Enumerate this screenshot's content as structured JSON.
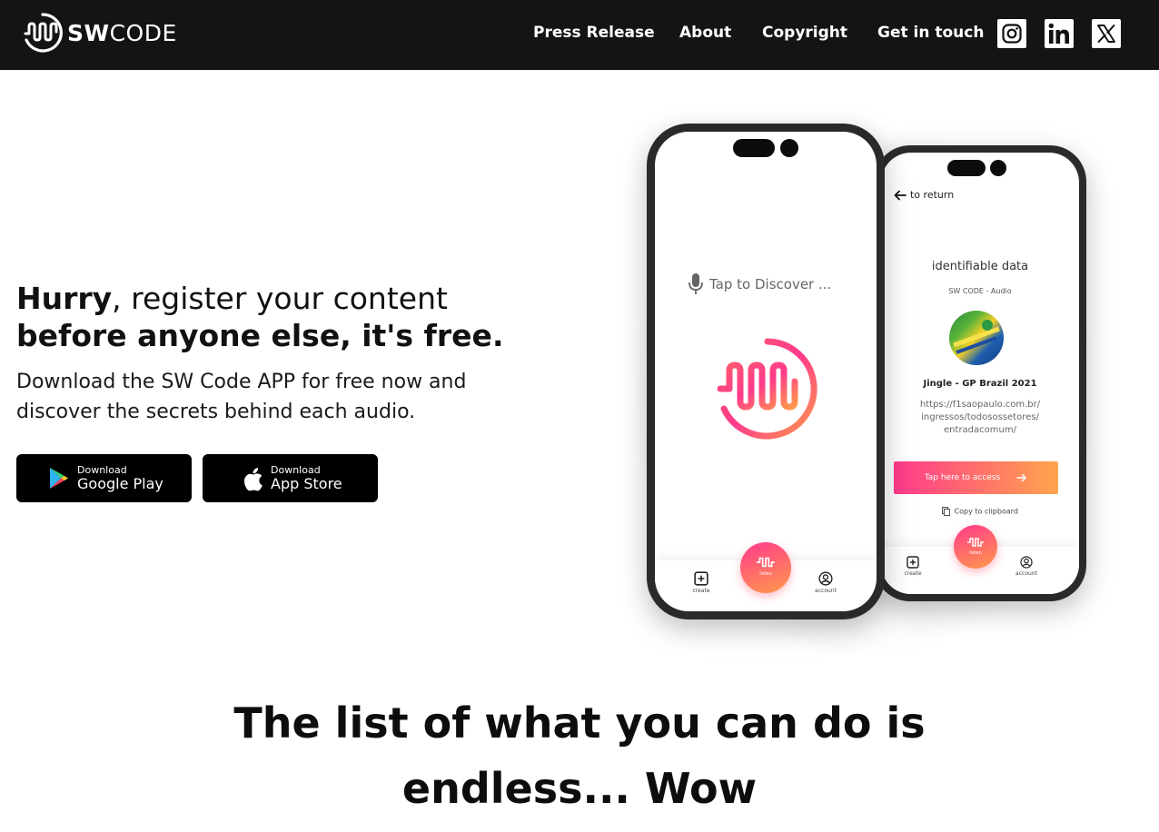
{
  "brand": {
    "name_bold": "SW",
    "name_light": "CODE"
  },
  "nav": {
    "links": [
      "Press Release",
      "About",
      "Copyright",
      "Get in touch"
    ],
    "social": [
      "instagram-icon",
      "linkedin-icon",
      "x-icon"
    ]
  },
  "hero": {
    "line1_bold": "Hurry",
    "line1_rest": ", register your content",
    "line2": "before anyone else, it's free.",
    "subtitle_line1": "Download the SW Code APP for free now and",
    "subtitle_line2": "discover the secrets behind each audio."
  },
  "stores": [
    {
      "small": "Download",
      "big": "Google Play",
      "icon": "google-play-icon"
    },
    {
      "small": "Download",
      "big": "App Store",
      "icon": "apple-icon"
    }
  ],
  "phone_left": {
    "prompt": "Tap to Discover ...",
    "tabs": {
      "create": "create",
      "listen": "listen",
      "account": "account"
    }
  },
  "phone_right": {
    "back": "to return",
    "heading": "identifiable data",
    "source": "SW CODE - Audio",
    "track": "Jingle - GP Brazil 2021",
    "url_line1": "https://f1saopaulo.com.br/",
    "url_line2": "ingressos/todosossetores/",
    "url_line3": "entradacomum/",
    "access_button": "Tap here to access",
    "copy_label": "Copy to clipboard",
    "tabs": {
      "create": "create",
      "listen": "listen",
      "account": "account"
    }
  },
  "section": {
    "title_line1": "The list of what you can do is",
    "title_line2": "endless... Wow"
  },
  "colors": {
    "nav_bg": "#141414",
    "gradient_start": "#ff3a8c",
    "gradient_end": "#ffa54c"
  }
}
